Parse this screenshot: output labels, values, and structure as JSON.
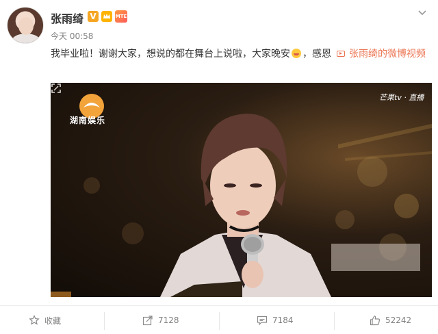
{
  "post": {
    "username": "张雨绮",
    "verified_badge": "V",
    "vip_badge": "MTE",
    "time": "今天 00:58",
    "text": "我毕业啦！谢谢大家，想说的都在舞台上说啦，大家晚安",
    "text_tail": "，感恩",
    "video_link": "张雨绮的微博视频",
    "emoji": "kiss-face-emoji"
  },
  "video": {
    "logo_text": "湖南娱乐",
    "channel_text": "芒果tv · 直播"
  },
  "actions": {
    "favorite_label": "收藏",
    "share_count": "7128",
    "comment_count": "7184",
    "like_count": "52242"
  },
  "colors": {
    "link": "#eb7350",
    "muted": "#808080",
    "verified": "#f5a623"
  },
  "icons": [
    "star-icon",
    "share-icon",
    "comment-icon",
    "thumbs-up-icon",
    "chevron-down-icon",
    "video-icon",
    "fullscreen-icon"
  ]
}
